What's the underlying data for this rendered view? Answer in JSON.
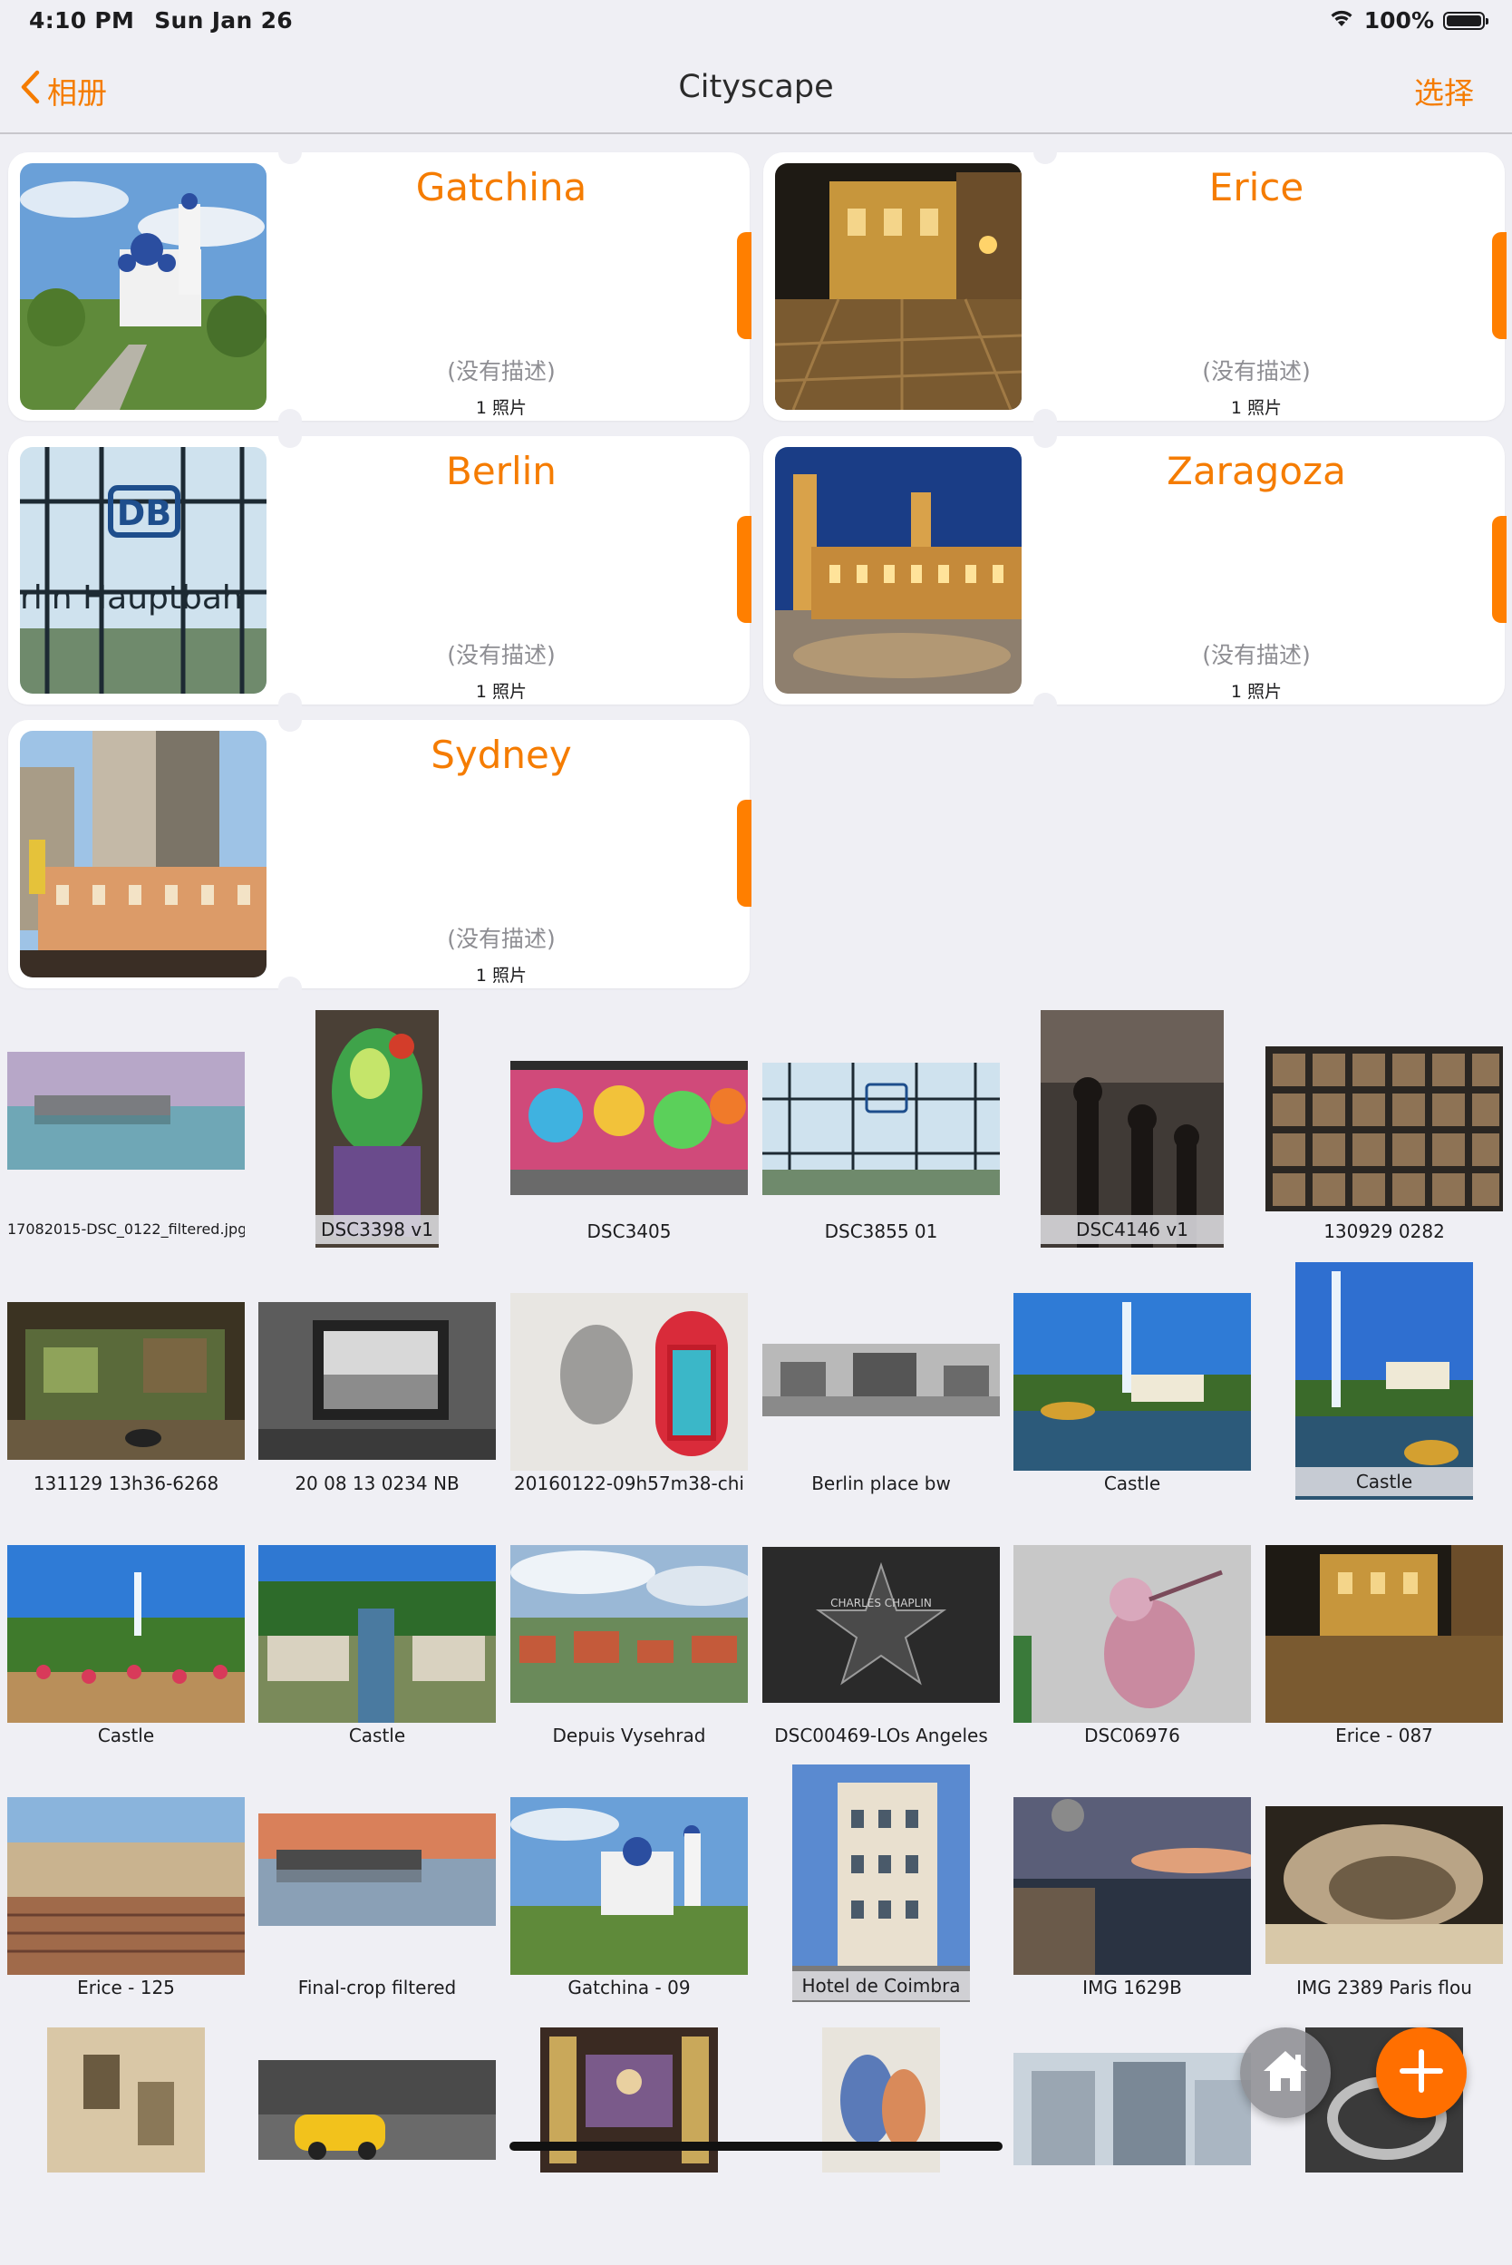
{
  "status_bar": {
    "time": "4:10 PM",
    "date": "Sun Jan 26",
    "battery": "100%"
  },
  "nav": {
    "back_label": "相册",
    "title": "Cityscape",
    "select_label": "选择"
  },
  "albums": [
    {
      "title": "Gatchina",
      "description": "(没有描述)",
      "count": "1 照片"
    },
    {
      "title": "Erice",
      "description": "(没有描述)",
      "count": "1 照片"
    },
    {
      "title": "Berlin",
      "description": "(没有描述)",
      "count": "1 照片"
    },
    {
      "title": "Zaragoza",
      "description": "(没有描述)",
      "count": "1 照片"
    },
    {
      "title": "Sydney",
      "description": "(没有描述)",
      "count": "1 照片"
    }
  ],
  "photos": [
    {
      "caption": "17082015-DSC_0122_filtered.jpg"
    },
    {
      "caption": "DSC3398 v1"
    },
    {
      "caption": "DSC3405"
    },
    {
      "caption": "DSC3855 01"
    },
    {
      "caption": "DSC4146 v1"
    },
    {
      "caption": "130929 0282"
    },
    {
      "caption": "131129 13h36-6268"
    },
    {
      "caption": "20 08 13 0234 NB"
    },
    {
      "caption": "20160122-09h57m38-chi"
    },
    {
      "caption": "Berlin place bw"
    },
    {
      "caption": "Castle"
    },
    {
      "caption": "Castle"
    },
    {
      "caption": "Castle"
    },
    {
      "caption": "Castle"
    },
    {
      "caption": "Depuis Vysehrad"
    },
    {
      "caption": "DSC00469-LOs Angeles"
    },
    {
      "caption": "DSC06976"
    },
    {
      "caption": "Erice - 087"
    },
    {
      "caption": "Erice - 125"
    },
    {
      "caption": "Final-crop filtered"
    },
    {
      "caption": "Gatchina - 09"
    },
    {
      "caption": "Hotel de Coimbra"
    },
    {
      "caption": "IMG 1629B"
    },
    {
      "caption": "IMG 2389 Paris flou"
    },
    {
      "caption": ""
    },
    {
      "caption": ""
    },
    {
      "caption": ""
    },
    {
      "caption": ""
    },
    {
      "caption": ""
    },
    {
      "caption": ""
    }
  ],
  "icons": {
    "back": "chevron-left-icon",
    "wifi": "wifi-icon",
    "battery": "battery-icon",
    "home": "home-icon",
    "add": "plus-icon"
  },
  "colors": {
    "accent": "#f57c00",
    "background": "#efeff4",
    "card": "#ffffff"
  }
}
